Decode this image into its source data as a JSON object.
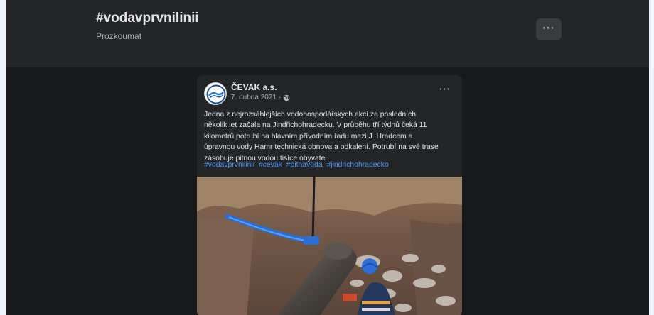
{
  "header": {
    "title": "#vodavprvnilinii",
    "subtitle": "Prozkoumat",
    "more_label": "···"
  },
  "post": {
    "author": "ČEVAK a.s.",
    "date": "7. dubna 2021",
    "separator": "·",
    "more_label": "···",
    "text_lines": [
      "Jedna z nejrozsáhlejších vodohospodářských akcí za posledních",
      "několik let začala na Jindřichohradecku. V průběhu tří týdnů čeká 11",
      "kilometrů potrubí na hlavním přívodním řadu mezi J. Hradcem a",
      "úpravnou vody Hamr technická obnova a odkalení. Potrubí na své trase",
      "zásobuje pitnou vodou tisíce obyvatel."
    ],
    "hashtags": [
      "#vodavprvnilinii",
      "#cevak",
      "#pitnavoda",
      "#jindrichohradecko"
    ]
  },
  "colors": {
    "background": "#18191a",
    "header": "#242526",
    "card": "#242526",
    "text_primary": "#e4e6eb",
    "text_secondary": "#b0b3b8",
    "link": "#4599ff"
  },
  "icons": {
    "avatar": "cevak-logo",
    "privacy": "globe-icon"
  }
}
